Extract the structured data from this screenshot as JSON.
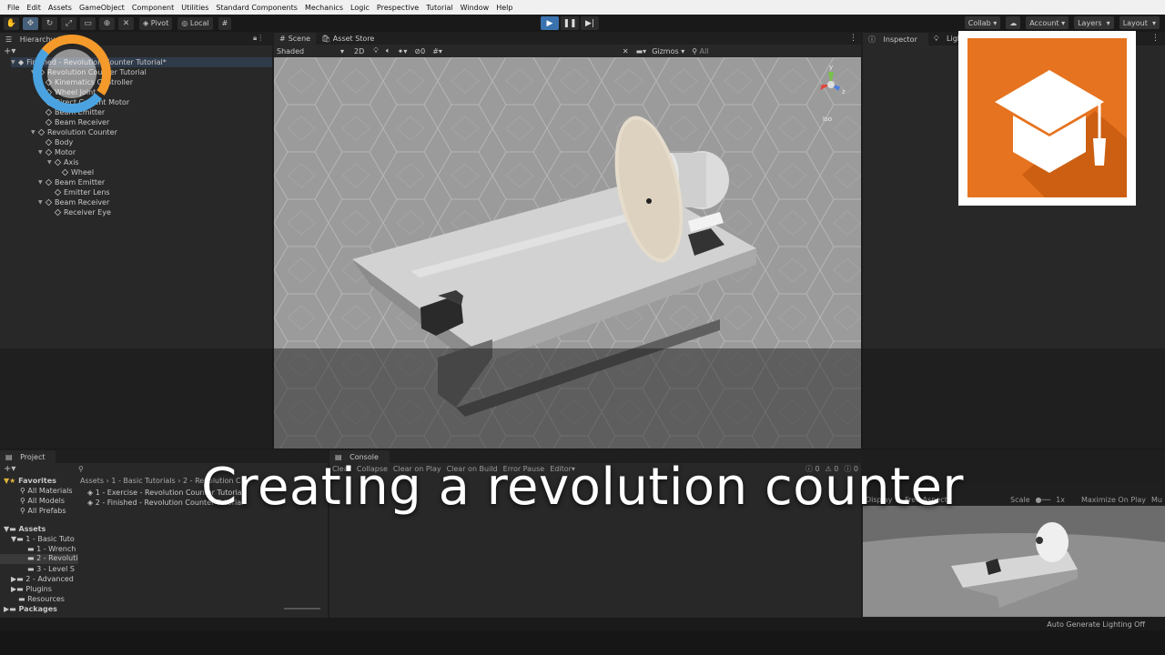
{
  "menu": [
    "File",
    "Edit",
    "Assets",
    "GameObject",
    "Component",
    "Utilities",
    "Standard Components",
    "Mechanics",
    "Logic",
    "Prespective",
    "Tutorial",
    "Window",
    "Help"
  ],
  "toolbar": {
    "pivot": "Pivot",
    "local": "Local",
    "collab": "Collab",
    "account": "Account",
    "layers": "Layers",
    "layout": "Layout"
  },
  "hierarchy": {
    "tab": "Hierarchy",
    "rows": [
      "Finished - Revolution Counter Tutorial*",
      "Revolution Counter Tutorial",
      "Kinematics Controller",
      "Wheel Joint",
      "Direct Current Motor",
      "Beam Emitter",
      "Beam Receiver",
      "Revolution Counter",
      "Body",
      "Motor",
      "Axis",
      "Wheel",
      "Beam Emitter",
      "Emitter Lens",
      "Beam Receiver",
      "Receiver Eye"
    ]
  },
  "scene": {
    "tab_scene": "Scene",
    "tab_store": "Asset Store",
    "shading": "Shaded",
    "mode_2d": "2D",
    "gizmos": "Gizmos",
    "search_placeholder": "All",
    "persp": "Iso"
  },
  "inspector": {
    "tab": "Inspector",
    "lighting": "Lighting"
  },
  "project": {
    "tab": "Project",
    "favorites": "Favorites",
    "fav_items": [
      "All Materials",
      "All Models",
      "All Prefabs"
    ],
    "assets": "Assets",
    "tree": [
      "1 - Basic Tuto",
      "1 - Wrench",
      "2 - Revoluti",
      "3 - Level S",
      "2 - Advanced",
      "Plugins",
      "Resources"
    ],
    "packages": "Packages",
    "breadcrumb": [
      "Assets",
      "1 - Basic Tutorials",
      "2 - Revolution C"
    ],
    "files": [
      "1 - Exercise - Revolution Counter Tutorial",
      "2 - Finished - Revolution Counter Tutorial"
    ]
  },
  "console": {
    "tab": "Console",
    "buttons": [
      "Clear",
      "Collapse",
      "Clear on Play",
      "Clear on Build",
      "Error Pause",
      "Editor"
    ],
    "counts": [
      "0",
      "0",
      "0"
    ]
  },
  "game": {
    "display": "Display 1",
    "aspect": "Free Aspect",
    "scale_label": "Scale",
    "scale_value": "1x",
    "maximize": "Maximize On Play",
    "mute": "Mu"
  },
  "status": "Auto Generate Lighting Off",
  "caption": "Creating a revolution counter",
  "colors": {
    "accent": "#3a72b0",
    "logo": "#e5731f"
  }
}
